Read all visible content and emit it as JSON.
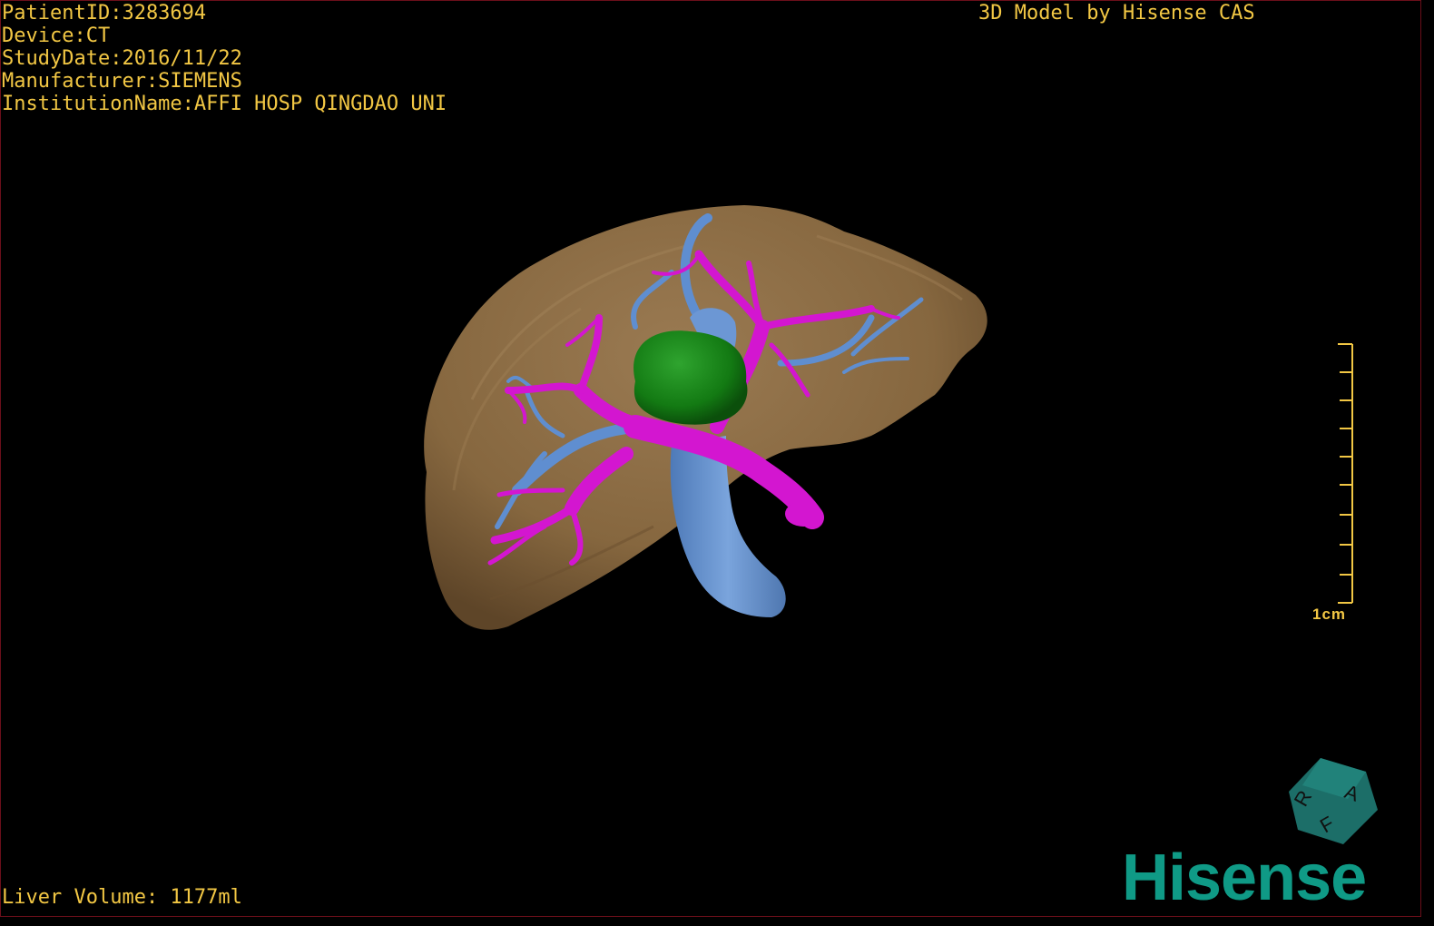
{
  "info": {
    "patient_id": "PatientID:3283694",
    "device": "Device:CT",
    "study_date": "StudyDate:2016/11/22",
    "manufacturer": "Manufacturer:SIEMENS",
    "institution": "InstitutionName:AFFI HOSP QINGDAO UNI"
  },
  "credit": "3D Model by Hisense CAS",
  "liver_volume": "Liver Volume: 1177ml",
  "scale_bar": {
    "label": "1cm",
    "ticks": 10
  },
  "orientation_cube": {
    "letters": [
      "A",
      "R",
      "F"
    ],
    "color": "#1c6e68"
  },
  "logo": {
    "text": "Hisense",
    "color": "#0f9a86"
  },
  "colors": {
    "overlay_text": "#f2c744",
    "liver": "#8a6a46",
    "tumor": "#1f8a1f",
    "portal_vein": "#d316d0",
    "hepatic_vein": "#5f8ed0",
    "background": "#000000"
  }
}
